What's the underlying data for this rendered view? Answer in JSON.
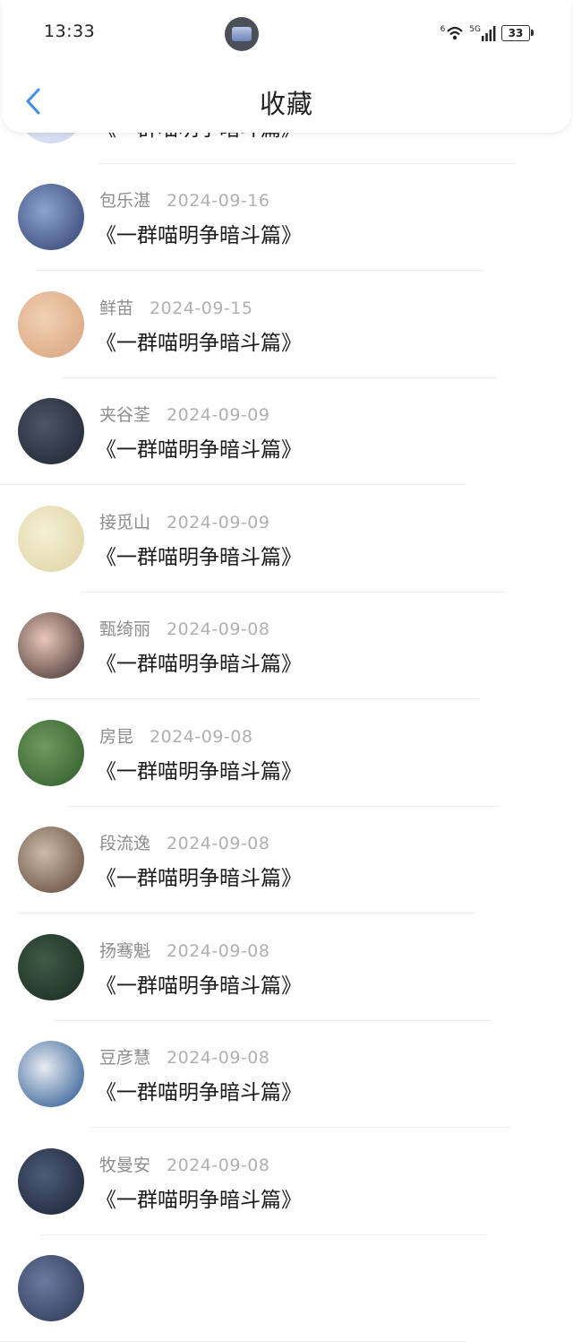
{
  "status_bar": {
    "time": "13:33",
    "battery": "33",
    "signal_label": "5G",
    "wifi_label": "6"
  },
  "header": {
    "title": "收藏",
    "back_icon": "chevron-left-icon"
  },
  "items": [
    {
      "name": "",
      "date": "",
      "title": "《一群喵明争暗斗篇》",
      "avatar_colors": [
        "#c9d3ee",
        "#eef2ff"
      ]
    },
    {
      "name": "包乐湛",
      "date": "2024-09-16",
      "title": "《一群喵明争暗斗篇》",
      "avatar_colors": [
        "#2d3f6e",
        "#8ea2cf"
      ]
    },
    {
      "name": "鲜苗",
      "date": "2024-09-15",
      "title": "《一群喵明争暗斗篇》",
      "avatar_colors": [
        "#d8a07a",
        "#f0d2b4"
      ]
    },
    {
      "name": "夹谷荃",
      "date": "2024-09-09",
      "title": "《一群喵明争暗斗篇》",
      "avatar_colors": [
        "#1d2330",
        "#4d5566"
      ]
    },
    {
      "name": "接觅山",
      "date": "2024-09-09",
      "title": "《一群喵明争暗斗篇》",
      "avatar_colors": [
        "#ddd3a2",
        "#f5efd4"
      ]
    },
    {
      "name": "甄绮丽",
      "date": "2024-09-08",
      "title": "《一群喵明争暗斗篇》",
      "avatar_colors": [
        "#3a2a2a",
        "#e9c7b8"
      ]
    },
    {
      "name": "房昆",
      "date": "2024-09-08",
      "title": "《一群喵明争暗斗篇》",
      "avatar_colors": [
        "#2d5a2c",
        "#6e9a5d"
      ]
    },
    {
      "name": "段流逸",
      "date": "2024-09-08",
      "title": "《一群喵明争暗斗篇》",
      "avatar_colors": [
        "#5b4336",
        "#cdbba8"
      ]
    },
    {
      "name": "扬骞魁",
      "date": "2024-09-08",
      "title": "《一群喵明争暗斗篇》",
      "avatar_colors": [
        "#1a2a22",
        "#3e5a45"
      ]
    },
    {
      "name": "豆彦慧",
      "date": "2024-09-08",
      "title": "《一群喵明争暗斗篇》",
      "avatar_colors": [
        "#1f4f8c",
        "#e8ecf2"
      ]
    },
    {
      "name": "牧曼安",
      "date": "2024-09-08",
      "title": "《一群喵明争暗斗篇》",
      "avatar_colors": [
        "#1b2333",
        "#4b5b78"
      ]
    },
    {
      "name": "",
      "date": "",
      "title": "",
      "avatar_colors": [
        "#2b3550",
        "#6a7aa0"
      ]
    }
  ]
}
